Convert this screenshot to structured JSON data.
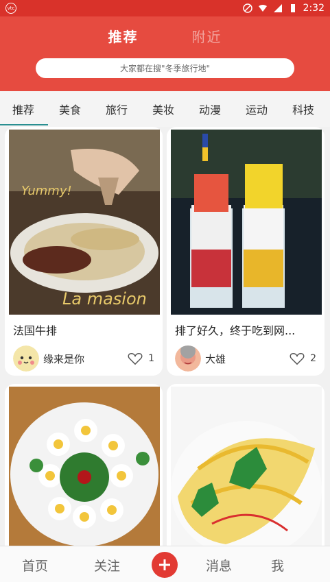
{
  "status_bar": {
    "time": "2:32"
  },
  "header": {
    "tabs": [
      {
        "label": "推荐",
        "active": true
      },
      {
        "label": "附近",
        "active": false
      }
    ],
    "search_placeholder": "大家都在搜\"冬季旅行地\""
  },
  "categories": [
    "推荐",
    "美食",
    "旅行",
    "美妆",
    "动漫",
    "运动",
    "科技"
  ],
  "feed": [
    {
      "title": "法国牛排",
      "author": "缘来是你",
      "likes": "1"
    },
    {
      "title": "排了好久，终于吃到网...",
      "author": "大雄",
      "likes": "2"
    },
    {
      "title": "",
      "author": "",
      "likes": ""
    },
    {
      "title": "",
      "author": "",
      "likes": ""
    }
  ],
  "bottom_nav": {
    "home": "首页",
    "follow": "关注",
    "messages": "消息",
    "me": "我"
  },
  "colors": {
    "header_bg": "#e64b40",
    "status_bg": "#d9322a",
    "accent": "#2a8f91"
  }
}
